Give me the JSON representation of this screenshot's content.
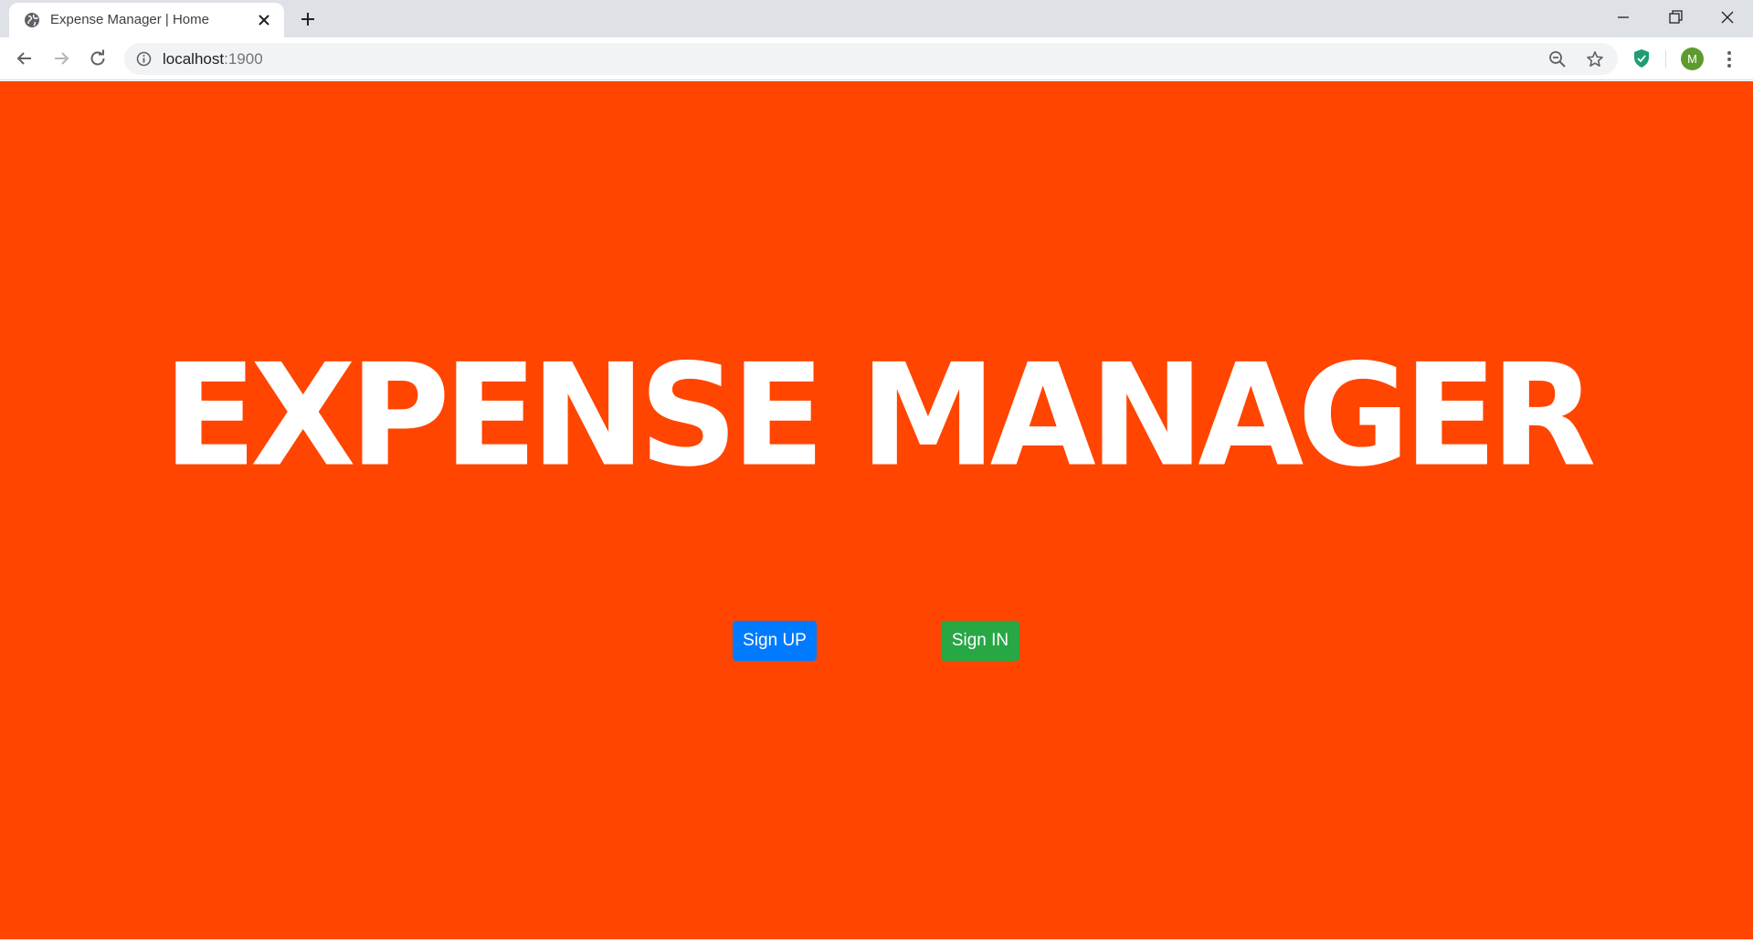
{
  "browser": {
    "tab": {
      "title": "Expense Manager | Home",
      "favicon": "globe-icon"
    },
    "address_bar": {
      "host": "localhost",
      "port": ":1900"
    },
    "profile_initial": "M",
    "icons": [
      "back-icon",
      "forward-icon",
      "reload-icon",
      "info-icon",
      "zoom-out-icon",
      "star-icon",
      "shield-extension-icon",
      "kebab-menu-icon",
      "minimize-icon",
      "restore-icon",
      "close-window-icon",
      "new-tab-icon",
      "tab-close-icon"
    ]
  },
  "page": {
    "background_color": "#ff4500",
    "hero_title": "EXPENSE MANAGER",
    "buttons": {
      "sign_up": {
        "label": "Sign UP",
        "color": "#007bff"
      },
      "sign_in": {
        "label": "Sign IN",
        "color": "#28a745"
      }
    }
  }
}
